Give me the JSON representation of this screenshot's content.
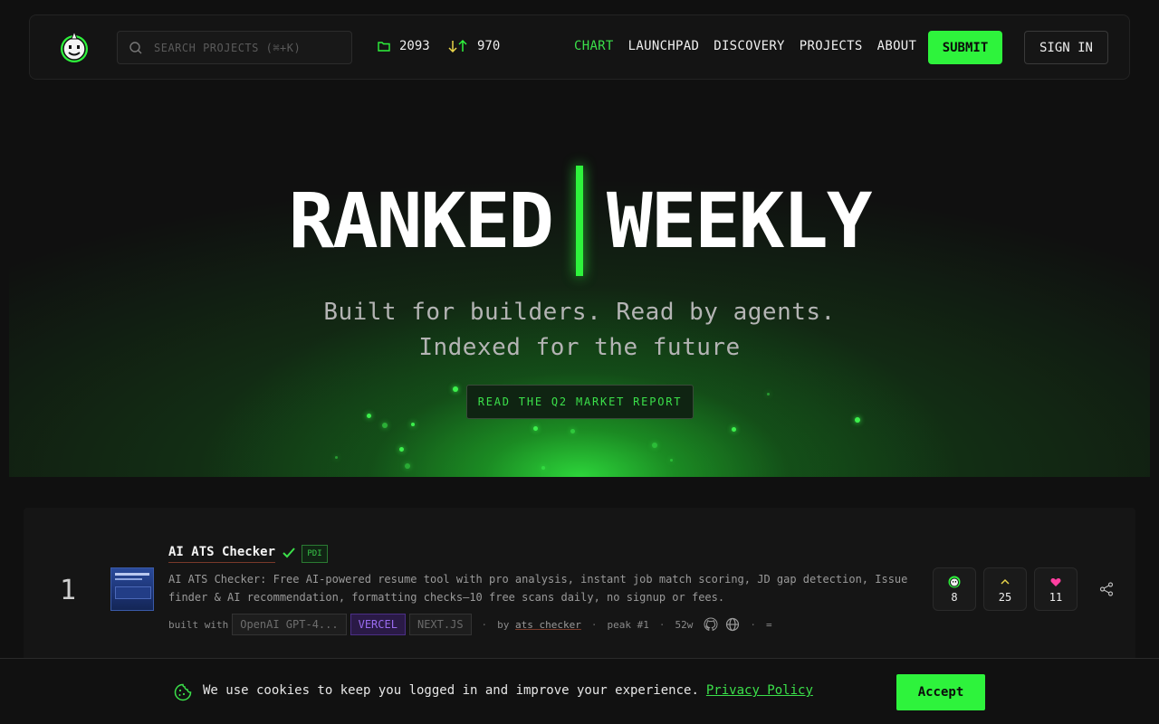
{
  "nav": {
    "search_placeholder": "SEARCH PROJECTS (⌘+K)",
    "projects_count": "2093",
    "votes_count": "970",
    "menu": [
      {
        "label": "CHART",
        "active": true
      },
      {
        "label": "LAUNCHPAD",
        "active": false
      },
      {
        "label": "DISCOVERY",
        "active": false
      },
      {
        "label": "PROJECTS",
        "active": false
      },
      {
        "label": "ABOUT",
        "active": false
      }
    ],
    "submit_label": "SUBMIT",
    "signin_label": "SIGN IN"
  },
  "hero": {
    "word_left": "RANKED",
    "word_right": "WEEKLY",
    "tagline_line1": "Built for builders. Read by agents.",
    "tagline_line2": "Indexed for the future",
    "cta_label": "READ THE Q2 MARKET REPORT"
  },
  "ranking": [
    {
      "rank": "1",
      "title": "AI ATS Checker",
      "badge": "PDI",
      "description": "AI ATS Checker: Free AI-powered resume tool with pro analysis, instant job match scoring, JD gap detection, Issue finder & AI recommendation, formatting checks—10 free scans daily, no signup or fees.",
      "built_with_label": "built with",
      "stack": [
        "OpenAI GPT-4...",
        "VERCEL",
        "NEXT.JS"
      ],
      "by_label": "by",
      "author": "ats checker",
      "peak": "peak #1",
      "age": "52w",
      "extra": "=",
      "counters": {
        "rocket": "8",
        "upvotes": "25",
        "likes": "11"
      }
    }
  ],
  "cookie": {
    "text": "We use cookies to keep you logged in and improve your experience.",
    "link": "Privacy Policy",
    "accept_label": "Accept"
  },
  "colors": {
    "accent": "#2ef33c",
    "background": "#101010",
    "vercel": "#9a6cf0",
    "like": "#ff3fa0"
  }
}
